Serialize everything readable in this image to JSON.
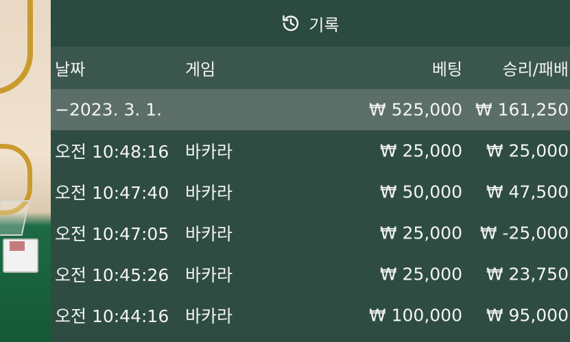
{
  "header": {
    "title": "기록",
    "icon": "history-icon"
  },
  "columns": {
    "date": "날짜",
    "game": "게임",
    "bet": "베팅",
    "result": "승리/패배"
  },
  "summary": {
    "date": "−2023. 3. 1.",
    "bet": "₩ 525,000",
    "result": "₩ 161,250"
  },
  "rows": [
    {
      "time": "오전 10:48:16",
      "game": "바카라",
      "bet": "₩ 25,000",
      "result": "₩ 25,000"
    },
    {
      "time": "오전 10:47:40",
      "game": "바카라",
      "bet": "₩ 50,000",
      "result": "₩ 47,500"
    },
    {
      "time": "오전 10:47:05",
      "game": "바카라",
      "bet": "₩ 25,000",
      "result": "₩ -25,000"
    },
    {
      "time": "오전 10:45:26",
      "game": "바카라",
      "bet": "₩ 25,000",
      "result": "₩ 23,750"
    },
    {
      "time": "오전 10:44:16",
      "game": "바카라",
      "bet": "₩ 100,000",
      "result": "₩ 95,000"
    }
  ],
  "colors": {
    "panel": "#2c4a40",
    "header_row": "#3a564d",
    "summary_row": "#5c6e68",
    "text": "#f4f4f4",
    "accent_gold": "#c99a2e"
  }
}
